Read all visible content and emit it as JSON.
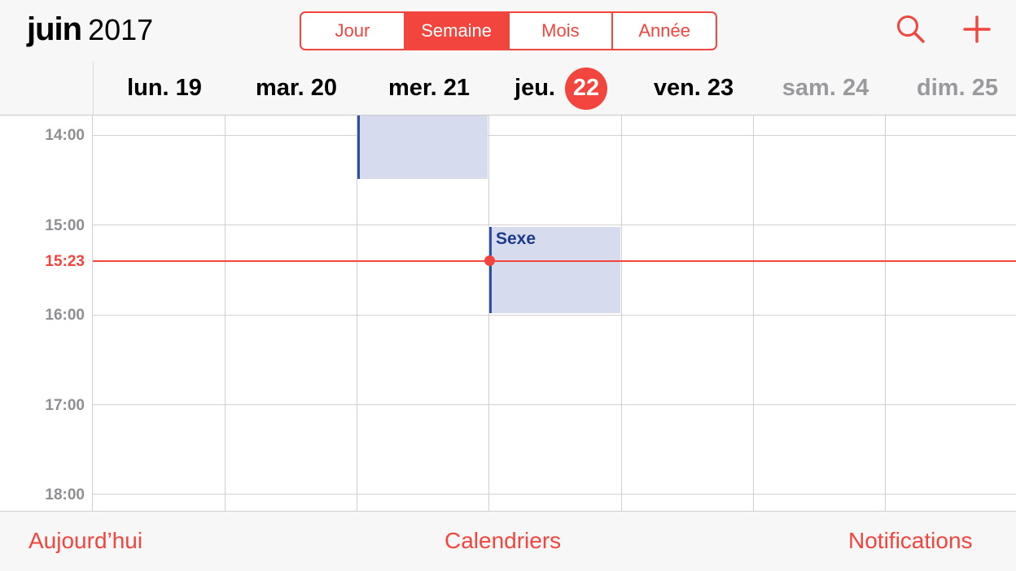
{
  "header": {
    "month": "juin",
    "year": "2017",
    "views": [
      "Jour",
      "Semaine",
      "Mois",
      "Année"
    ],
    "active_view": "Semaine",
    "search_icon": "search-icon",
    "add_icon": "plus-icon"
  },
  "days": [
    {
      "name": "lun.",
      "num": "19",
      "weekend": false,
      "today": false
    },
    {
      "name": "mar.",
      "num": "20",
      "weekend": false,
      "today": false
    },
    {
      "name": "mer.",
      "num": "21",
      "weekend": false,
      "today": false
    },
    {
      "name": "jeu.",
      "num": "22",
      "weekend": false,
      "today": true
    },
    {
      "name": "ven.",
      "num": "23",
      "weekend": false,
      "today": false
    },
    {
      "name": "sam.",
      "num": "24",
      "weekend": true,
      "today": false
    },
    {
      "name": "dim.",
      "num": "25",
      "weekend": true,
      "today": false
    }
  ],
  "hours": [
    "14:00",
    "15:00",
    "16:00",
    "17:00",
    "18:00"
  ],
  "current_time": "15:23",
  "events": [
    {
      "title": "",
      "day": "mer. 21"
    },
    {
      "title": "Sexe",
      "day": "jeu. 22"
    }
  ],
  "toolbar": {
    "today": "Aujourd’hui",
    "calendars": "Calendriers",
    "notifications": "Notifications"
  },
  "colors": {
    "accent": "#f1453d",
    "event_fill": "#d6dcee",
    "event_bar": "#2f4fa2",
    "event_text": "#1d3a8a"
  }
}
